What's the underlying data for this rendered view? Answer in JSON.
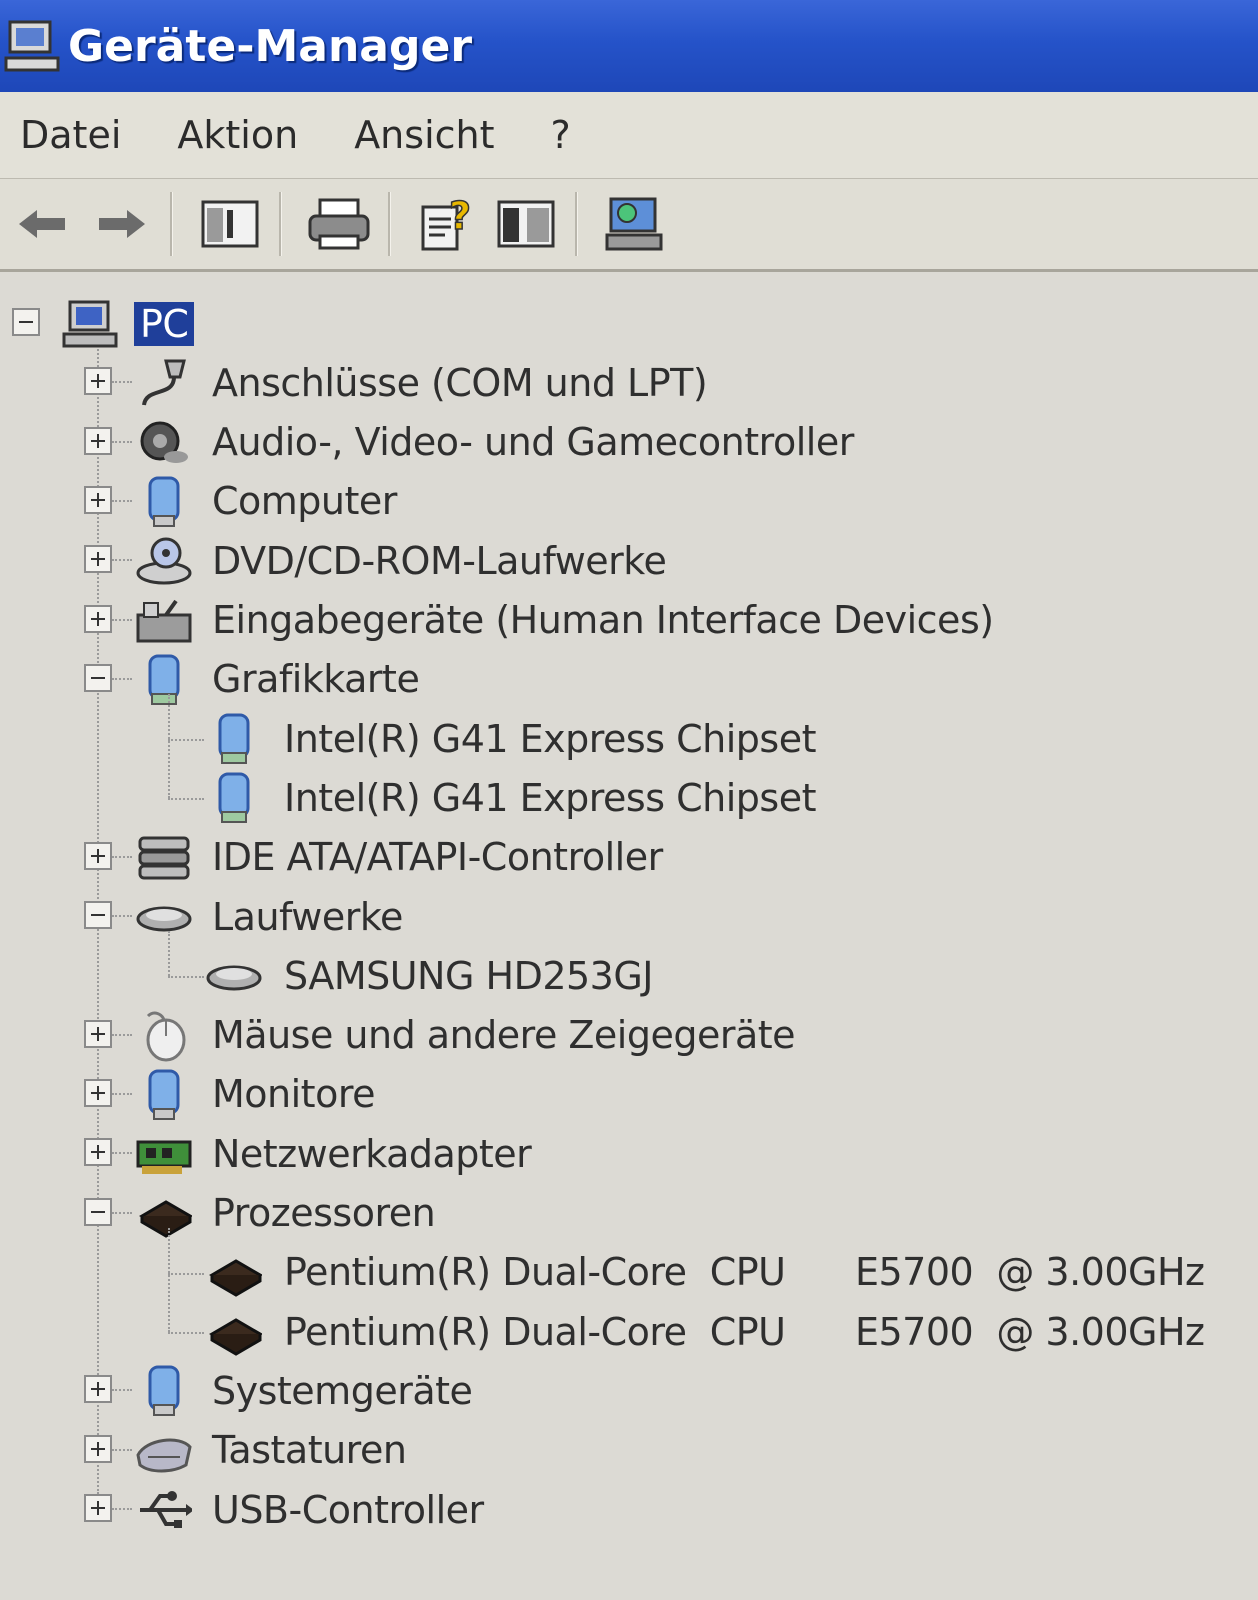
{
  "window": {
    "title": "Geräte-Manager"
  },
  "menu": [
    "Datei",
    "Aktion",
    "Ansicht",
    "?"
  ],
  "toolbar": {
    "buttons": [
      "back-icon",
      "forward-icon",
      "console-tree-icon",
      "print-icon",
      "help-properties-icon",
      "view-pane-icon",
      "scan-hardware-icon"
    ]
  },
  "tree": {
    "root": "PC",
    "categories": [
      {
        "label": "Anschlüsse (COM und LPT)",
        "expanded": false,
        "icon": "port-icon",
        "children": []
      },
      {
        "label": "Audio-, Video- und Gamecontroller",
        "expanded": false,
        "icon": "speaker-icon",
        "children": []
      },
      {
        "label": "Computer",
        "expanded": false,
        "icon": "computer-icon",
        "children": []
      },
      {
        "label": "DVD/CD-ROM-Laufwerke",
        "expanded": false,
        "icon": "cdrom-icon",
        "children": []
      },
      {
        "label": "Eingabegeräte (Human Interface Devices)",
        "expanded": false,
        "icon": "hid-icon",
        "children": []
      },
      {
        "label": "Grafikkarte",
        "expanded": true,
        "icon": "display-adapter-icon",
        "children": [
          "Intel(R) G41 Express Chipset",
          "Intel(R) G41 Express Chipset"
        ]
      },
      {
        "label": "IDE ATA/ATAPI-Controller",
        "expanded": false,
        "icon": "ide-controller-icon",
        "children": []
      },
      {
        "label": "Laufwerke",
        "expanded": true,
        "icon": "disk-drive-icon",
        "children": [
          "SAMSUNG HD253GJ"
        ]
      },
      {
        "label": "Mäuse und andere Zeigegeräte",
        "expanded": false,
        "icon": "mouse-icon",
        "children": []
      },
      {
        "label": "Monitore",
        "expanded": false,
        "icon": "monitor-icon",
        "children": []
      },
      {
        "label": "Netzwerkadapter",
        "expanded": false,
        "icon": "network-adapter-icon",
        "children": []
      },
      {
        "label": "Prozessoren",
        "expanded": true,
        "icon": "processor-icon",
        "children": [
          "Pentium(R) Dual-Core  CPU      E5700  @ 3.00GHz",
          "Pentium(R) Dual-Core  CPU      E5700  @ 3.00GHz"
        ]
      },
      {
        "label": "Systemgeräte",
        "expanded": false,
        "icon": "system-devices-icon",
        "children": []
      },
      {
        "label": "Tastaturen",
        "expanded": false,
        "icon": "keyboard-icon",
        "children": []
      },
      {
        "label": "USB-Controller",
        "expanded": false,
        "icon": "usb-icon",
        "children": []
      }
    ]
  },
  "colors": {
    "titlebar": "#2553c9",
    "selection": "#1f3f9a",
    "background": "#dcdad4"
  }
}
